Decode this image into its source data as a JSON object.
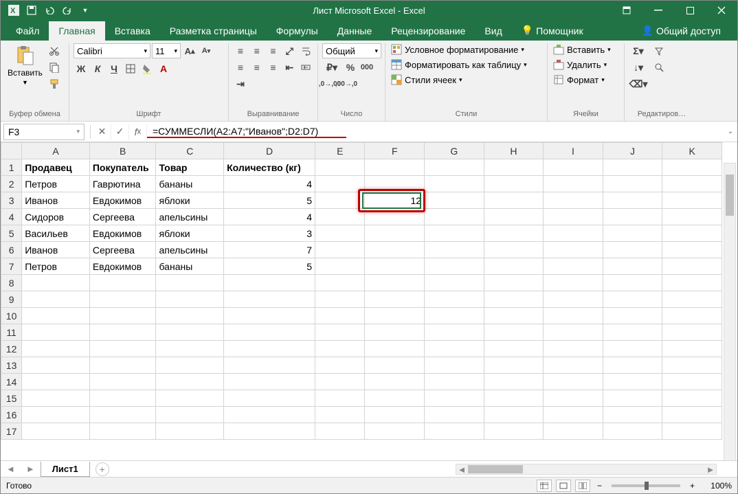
{
  "title": "Лист Microsoft Excel - Excel",
  "tabs": {
    "file": "Файл",
    "home": "Главная",
    "insert": "Вставка",
    "layout": "Разметка страницы",
    "formulas": "Формулы",
    "data": "Данные",
    "review": "Рецензирование",
    "view": "Вид",
    "help": "Помощник",
    "share": "Общий доступ"
  },
  "groups": {
    "clipboard": "Буфер обмена",
    "font": "Шрифт",
    "alignment": "Выравнивание",
    "number": "Число",
    "styles": "Стили",
    "cells": "Ячейки",
    "editing": "Редактиров…"
  },
  "font": {
    "name": "Calibri",
    "size": "11"
  },
  "paste": "Вставить",
  "number_format": "Общий",
  "styles": {
    "cond": "Условное форматирование",
    "table": "Форматировать как таблицу",
    "cell": "Стили ячеек"
  },
  "cells": {
    "insert": "Вставить",
    "delete": "Удалить",
    "format": "Формат"
  },
  "namebox": "F3",
  "formula": "=СУММЕСЛИ(A2:A7;\"Иванов\";D2:D7)",
  "columns": [
    "A",
    "B",
    "C",
    "D",
    "E",
    "F",
    "G",
    "H",
    "I",
    "J",
    "K"
  ],
  "headers": {
    "a": "Продавец",
    "b": "Покупатель",
    "c": "Товар",
    "d": "Количество (кг)"
  },
  "rows": [
    {
      "a": "Петров",
      "b": "Гаврютина",
      "c": "бананы",
      "d": "4"
    },
    {
      "a": "Иванов",
      "b": "Евдокимов",
      "c": "яблоки",
      "d": "5"
    },
    {
      "a": "Сидоров",
      "b": "Сергеева",
      "c": "апельсины",
      "d": "4"
    },
    {
      "a": "Васильев",
      "b": "Евдокимов",
      "c": "яблоки",
      "d": "3"
    },
    {
      "a": "Иванов",
      "b": "Сергеева",
      "c": "апельсины",
      "d": "7"
    },
    {
      "a": "Петров",
      "b": "Евдокимов",
      "c": "бананы",
      "d": "5"
    }
  ],
  "result_f3": "12",
  "sheet_name": "Лист1",
  "status": "Готово",
  "zoom": "100%"
}
